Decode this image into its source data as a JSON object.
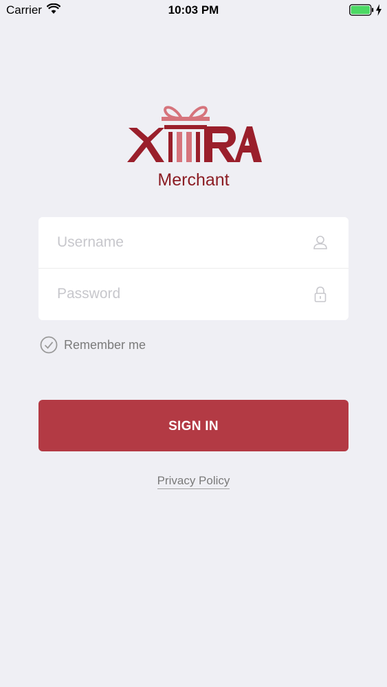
{
  "status_bar": {
    "carrier": "Carrier",
    "time": "10:03 PM",
    "wifi_icon": "wifi-icon",
    "battery_icon": "battery-icon",
    "battery_level": 1.0,
    "charging_icon": "bolt-icon",
    "battery_color": "#4cd964"
  },
  "logo": {
    "brand_text": "XTRA",
    "sub_text": "Merchant",
    "brand_color": "#9a1f2b",
    "bow_color": "#d6747c"
  },
  "form": {
    "username": {
      "placeholder": "Username",
      "value": "",
      "icon": "user-icon"
    },
    "password": {
      "placeholder": "Password",
      "value": "",
      "icon": "lock-icon"
    },
    "remember_me": {
      "label": "Remember me",
      "checked": false,
      "icon": "check-circle-icon"
    }
  },
  "actions": {
    "sign_in_label": "SIGN IN",
    "sign_in_color": "#b33a44",
    "privacy_label": "Privacy Policy"
  }
}
